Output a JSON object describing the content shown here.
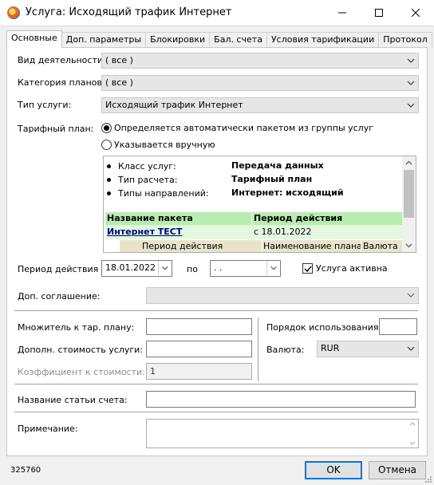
{
  "window": {
    "title": "Услуга: Исходящий трафик Интернет"
  },
  "tabs": [
    {
      "label": "Основные"
    },
    {
      "label": "Доп. параметры"
    },
    {
      "label": "Блокировки"
    },
    {
      "label": "Бал. счета"
    },
    {
      "label": "Условия тарификации"
    },
    {
      "label": "Протокол"
    }
  ],
  "form": {
    "activity_label": "Вид деятельности:",
    "activity_value": "( все )",
    "plan_category_label": "Категория планов:",
    "plan_category_value": "( все )",
    "service_type_label": "Тип услуги:",
    "service_type_value": "Исходящий трафик Интернет",
    "tariff_plan_label": "Тарифный план:",
    "radio_auto": "Определяется автоматически пакетом из группы услуг",
    "radio_manual": "Указывается вручную",
    "info": {
      "service_class_label": "Класс услуг:",
      "service_class_value": "Передача данных",
      "calc_type_label": "Тип расчета:",
      "calc_type_value": "Тарифный план",
      "direction_types_label": "Типы направлений:",
      "direction_types_value": "Интернет: исходящий",
      "packages_header": {
        "name": "Название пакета",
        "period": "Период действия"
      },
      "package": {
        "name": "Интернет ТЕСТ",
        "period": "с 18.01.2022"
      },
      "sub_header": {
        "period": "Период действия",
        "plan_name": "Наименование плана",
        "currency": "Валюта"
      }
    },
    "period_from_label": "Период действия с",
    "period_from_value": "18.01.2022",
    "period_to_label": "по",
    "period_to_value": ". .",
    "service_active_label": "Услуга активна",
    "extra_agreement_label": "Доп. соглашение:",
    "multiplier_label": "Множитель к тар. плану:",
    "extra_cost_label": "Дополн. стоимость услуги:",
    "cost_coef_label": "Коэффициент к стоимости:",
    "cost_coef_value": "1",
    "usage_order_label": "Порядок использования:",
    "currency_label": "Валюта:",
    "currency_value": "RUR",
    "invoice_item_label": "Название статьи счета:",
    "note_label": "Примечание:"
  },
  "footer": {
    "id_text": "325760",
    "ok_label": "OK",
    "cancel_label": "Отмена"
  }
}
